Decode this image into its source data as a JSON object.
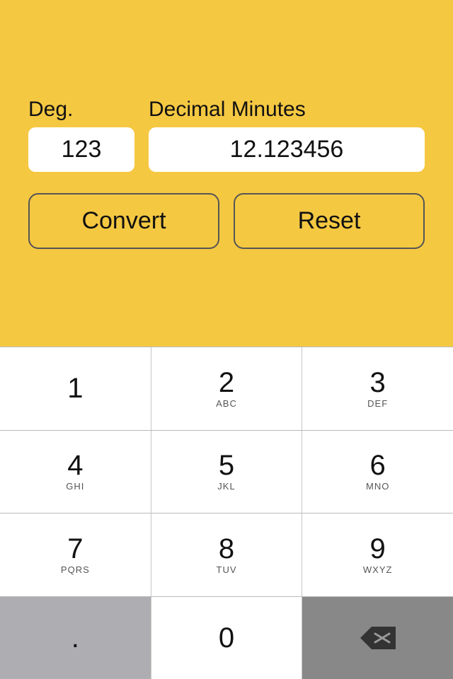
{
  "top": {
    "background_color": "#F5C842",
    "deg_label": "Deg.",
    "decmin_label": "Decimal Minutes",
    "deg_value": "123",
    "decmin_value": "12.123456",
    "convert_label": "Convert",
    "reset_label": "Reset"
  },
  "keyboard": {
    "rows": [
      [
        {
          "num": "1",
          "letters": ""
        },
        {
          "num": "2",
          "letters": "ABC"
        },
        {
          "num": "3",
          "letters": "DEF"
        }
      ],
      [
        {
          "num": "4",
          "letters": "GHI"
        },
        {
          "num": "5",
          "letters": "JKL"
        },
        {
          "num": "6",
          "letters": "MNO"
        }
      ],
      [
        {
          "num": "7",
          "letters": "PQRS"
        },
        {
          "num": "8",
          "letters": "TUV"
        },
        {
          "num": "9",
          "letters": "WXYZ"
        }
      ],
      [
        {
          "num": ".",
          "letters": "",
          "type": "special"
        },
        {
          "num": "0",
          "letters": "",
          "type": "normal"
        },
        {
          "num": "⌫",
          "letters": "",
          "type": "backspace"
        }
      ]
    ]
  }
}
